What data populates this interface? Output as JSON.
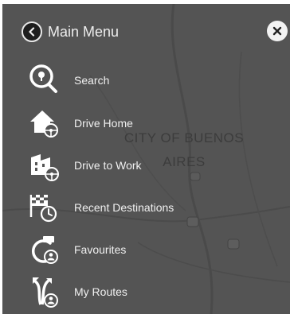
{
  "header": {
    "back_icon": "chevron-left-icon",
    "title": "Main Menu",
    "close_icon": "close-icon"
  },
  "map": {
    "city_line1": "CITY OF BUENOS",
    "city_line2": "AIRES"
  },
  "menu": {
    "items": [
      {
        "label": "Search",
        "icon": "search-icon"
      },
      {
        "label": "Drive Home",
        "icon": "drive-home-icon"
      },
      {
        "label": "Drive to Work",
        "icon": "drive-to-work-icon"
      },
      {
        "label": "Recent Destinations",
        "icon": "recent-destinations-icon"
      },
      {
        "label": "Favourites",
        "icon": "favourites-icon"
      },
      {
        "label": "My Routes",
        "icon": "my-routes-icon"
      }
    ]
  },
  "colors": {
    "background": "#545454",
    "text": "#f0f0f0",
    "icon": "#ffffff"
  }
}
